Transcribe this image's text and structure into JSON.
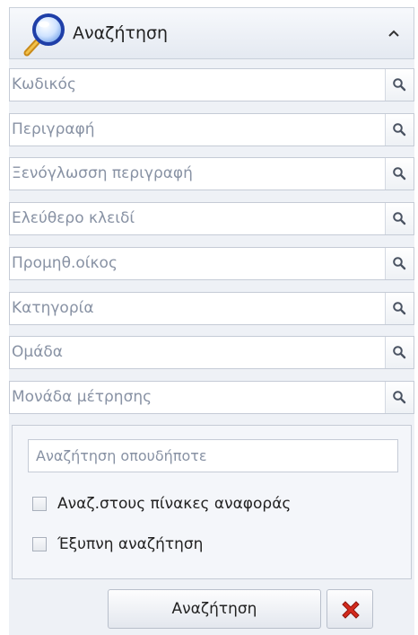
{
  "header": {
    "title": "Αναζήτηση",
    "icon": "magnifier-icon",
    "collapse_icon": "chevron-up-icon"
  },
  "fields": [
    {
      "label": "Κωδικός"
    },
    {
      "label": "Περιγραφή"
    },
    {
      "label": "Ξενόγλωσση περιγραφή"
    },
    {
      "label": "Ελεύθερο κλειδί"
    },
    {
      "label": "Προμηθ.οίκος"
    },
    {
      "label": "Κατηγορία"
    },
    {
      "label": "Ομάδα"
    },
    {
      "label": "Μονάδα μέτρησης"
    }
  ],
  "search_anywhere": {
    "placeholder": "Αναζήτηση οπουδήποτε"
  },
  "options": {
    "lookup_tables_label": "Αναζ.στους πίνακες αναφοράς",
    "smart_search_label": "Έξυπνη αναζήτηση"
  },
  "actions": {
    "search_label": "Αναζήτηση",
    "cancel_icon": "red-x-icon"
  },
  "colors": {
    "accent_red": "#d42a1e",
    "border": "#c5cbd6",
    "panel_bg": "#eef1f6"
  }
}
